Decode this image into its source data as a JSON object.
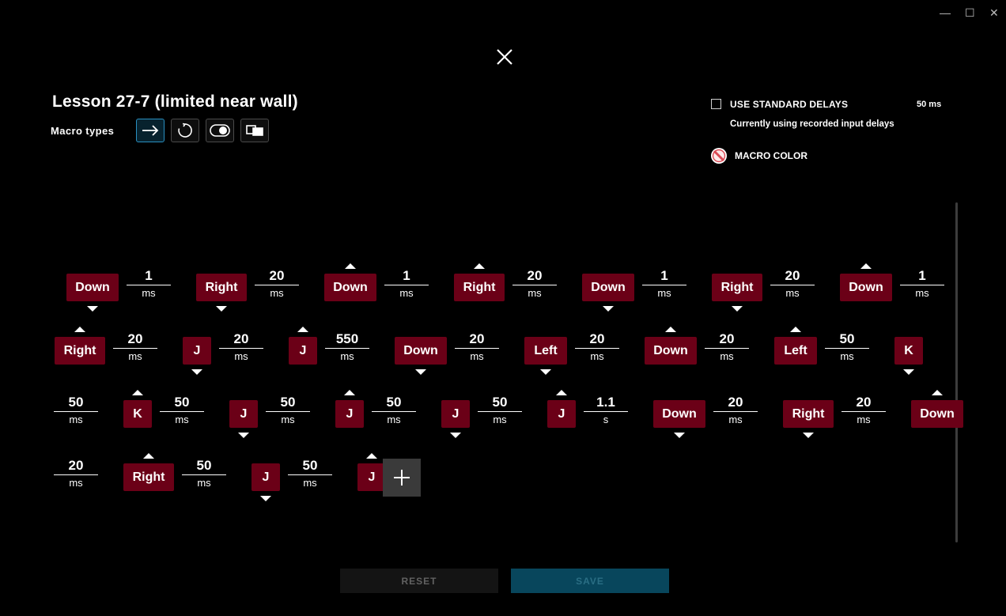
{
  "window": {
    "minimize_glyph": "—",
    "maximize_glyph": "☐",
    "close_glyph": "✕"
  },
  "dialog": {
    "title": "Lesson 27-7 (limited near wall)",
    "macro_types_label": "Macro types",
    "macro_types": [
      {
        "icon": "arrow-right-icon",
        "active": true
      },
      {
        "icon": "repeat-icon",
        "active": false
      },
      {
        "icon": "toggle-icon",
        "active": false
      },
      {
        "icon": "sequence-icon",
        "active": false
      }
    ],
    "standard_delays": {
      "label": "USE STANDARD DELAYS",
      "checked": false,
      "value": "50 ms",
      "subtext": "Currently using recorded input delays"
    },
    "macro_color": {
      "label": "MACRO COLOR",
      "icon": "no-color-icon"
    },
    "accent_color": "#2a8fc0",
    "key_color": "#6b0017"
  },
  "sequence": [
    [
      {
        "kind": "key",
        "label": "Down",
        "dir": "down"
      },
      {
        "kind": "delay",
        "value": "1",
        "unit": "ms"
      },
      {
        "kind": "key",
        "label": "Right",
        "dir": "down"
      },
      {
        "kind": "delay",
        "value": "20",
        "unit": "ms"
      },
      {
        "kind": "key",
        "label": "Down",
        "dir": "up"
      },
      {
        "kind": "delay",
        "value": "1",
        "unit": "ms"
      },
      {
        "kind": "key",
        "label": "Right",
        "dir": "up"
      },
      {
        "kind": "delay",
        "value": "20",
        "unit": "ms"
      },
      {
        "kind": "key",
        "label": "Down",
        "dir": "down"
      },
      {
        "kind": "delay",
        "value": "1",
        "unit": "ms"
      },
      {
        "kind": "key",
        "label": "Right",
        "dir": "down"
      },
      {
        "kind": "delay",
        "value": "20",
        "unit": "ms"
      },
      {
        "kind": "key",
        "label": "Down",
        "dir": "up"
      },
      {
        "kind": "delay",
        "value": "1",
        "unit": "ms"
      }
    ],
    [
      {
        "kind": "key",
        "label": "Right",
        "dir": "up"
      },
      {
        "kind": "delay",
        "value": "20",
        "unit": "ms"
      },
      {
        "kind": "key",
        "label": "J",
        "dir": "down"
      },
      {
        "kind": "delay",
        "value": "20",
        "unit": "ms"
      },
      {
        "kind": "key",
        "label": "J",
        "dir": "up"
      },
      {
        "kind": "delay",
        "value": "550",
        "unit": "ms"
      },
      {
        "kind": "key",
        "label": "Down",
        "dir": "down"
      },
      {
        "kind": "delay",
        "value": "20",
        "unit": "ms"
      },
      {
        "kind": "key",
        "label": "Left",
        "dir": "down"
      },
      {
        "kind": "delay",
        "value": "20",
        "unit": "ms"
      },
      {
        "kind": "key",
        "label": "Down",
        "dir": "up"
      },
      {
        "kind": "delay",
        "value": "20",
        "unit": "ms"
      },
      {
        "kind": "key",
        "label": "Left",
        "dir": "up"
      },
      {
        "kind": "delay",
        "value": "50",
        "unit": "ms"
      },
      {
        "kind": "key",
        "label": "K",
        "dir": "down"
      }
    ],
    [
      {
        "kind": "delay",
        "value": "50",
        "unit": "ms"
      },
      {
        "kind": "key",
        "label": "K",
        "dir": "up"
      },
      {
        "kind": "delay",
        "value": "50",
        "unit": "ms"
      },
      {
        "kind": "key",
        "label": "J",
        "dir": "down"
      },
      {
        "kind": "delay",
        "value": "50",
        "unit": "ms"
      },
      {
        "kind": "key",
        "label": "J",
        "dir": "up"
      },
      {
        "kind": "delay",
        "value": "50",
        "unit": "ms"
      },
      {
        "kind": "key",
        "label": "J",
        "dir": "down"
      },
      {
        "kind": "delay",
        "value": "50",
        "unit": "ms"
      },
      {
        "kind": "key",
        "label": "J",
        "dir": "up"
      },
      {
        "kind": "delay",
        "value": "1.1",
        "unit": "s"
      },
      {
        "kind": "key",
        "label": "Down",
        "dir": "down"
      },
      {
        "kind": "delay",
        "value": "20",
        "unit": "ms"
      },
      {
        "kind": "key",
        "label": "Right",
        "dir": "down"
      },
      {
        "kind": "delay",
        "value": "20",
        "unit": "ms"
      },
      {
        "kind": "key",
        "label": "Down",
        "dir": "up"
      }
    ],
    [
      {
        "kind": "delay",
        "value": "20",
        "unit": "ms"
      },
      {
        "kind": "key",
        "label": "Right",
        "dir": "up"
      },
      {
        "kind": "delay",
        "value": "50",
        "unit": "ms"
      },
      {
        "kind": "key",
        "label": "J",
        "dir": "down"
      },
      {
        "kind": "delay",
        "value": "50",
        "unit": "ms"
      },
      {
        "kind": "key",
        "label": "J",
        "dir": "up"
      }
    ]
  ],
  "add_button": {
    "icon": "plus-icon"
  },
  "footer": {
    "reset_label": "RESET",
    "save_label": "SAVE"
  }
}
